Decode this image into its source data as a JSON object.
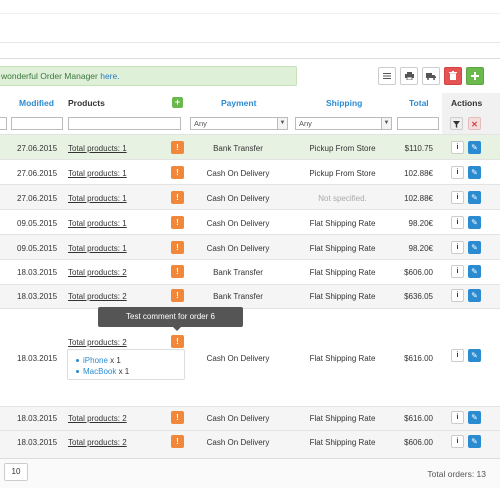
{
  "alert": {
    "text": "wonderful Order Manager ",
    "link": "here."
  },
  "toolbar": {
    "list_icon": "list-icon",
    "print_icon": "print-icon",
    "truck_icon": "truck-icon",
    "delete_icon": "trash-icon",
    "add_icon": "plus-icon"
  },
  "columns": {
    "modified": "Modified",
    "products": "Products",
    "payment": "Payment",
    "shipping": "Shipping",
    "total": "Total",
    "actions": "Actions"
  },
  "filters": {
    "payment_value": "Any",
    "shipping_value": "Any"
  },
  "rows": [
    {
      "date": "27.06.2015",
      "products": "Total products: 1",
      "payment": "Bank Transfer",
      "shipping": "Pickup From Store",
      "total": "$110.75"
    },
    {
      "date": "27.06.2015",
      "products": "Total products: 1",
      "payment": "Cash On Delivery",
      "shipping": "Pickup From Store",
      "total": "102.88€"
    },
    {
      "date": "27.06.2015",
      "products": "Total products: 1",
      "payment": "Cash On Delivery",
      "shipping": "Not specified.",
      "total": "102.88€"
    },
    {
      "date": "09.05.2015",
      "products": "Total products: 1",
      "payment": "Cash On Delivery",
      "shipping": "Flat Shipping Rate",
      "total": "98.20€"
    },
    {
      "date": "09.05.2015",
      "products": "Total products: 1",
      "payment": "Cash On Delivery",
      "shipping": "Flat Shipping Rate",
      "total": "98.20€"
    },
    {
      "date": "18.03.2015",
      "products": "Total products: 2",
      "payment": "Bank Transfer",
      "shipping": "Flat Shipping Rate",
      "total": "$606.00"
    },
    {
      "date": "18.03.2015",
      "products": "Total products: 2",
      "payment": "Bank Transfer",
      "shipping": "Flat Shipping Rate",
      "total": "$636.05"
    },
    {
      "date": "18.03.2015",
      "products": "Total products: 2",
      "payment": "Cash On Delivery",
      "shipping": "Flat Shipping Rate",
      "total": "$616.00"
    },
    {
      "date": "18.03.2015",
      "products": "Total products: 2",
      "payment": "Cash On Delivery",
      "shipping": "Flat Shipping Rate",
      "total": "$616.00"
    },
    {
      "date": "18.03.2015",
      "products": "Total products: 2",
      "payment": "Cash On Delivery",
      "shipping": "Flat Shipping Rate",
      "total": "$606.00"
    }
  ],
  "warn_glyph": "!",
  "info_glyph": "i",
  "tooltip": "Test comment for order 6",
  "expanded_products": [
    {
      "name": "iPhone",
      "qty": " x 1"
    },
    {
      "name": "MacBook",
      "qty": " x 1"
    }
  ],
  "footer": {
    "page_size": "10",
    "total_orders": "Total orders: 13"
  },
  "colors": {
    "accent": "#2a8bd1",
    "warning": "#f0873a",
    "success": "#6bb84f",
    "danger": "#e55454"
  }
}
